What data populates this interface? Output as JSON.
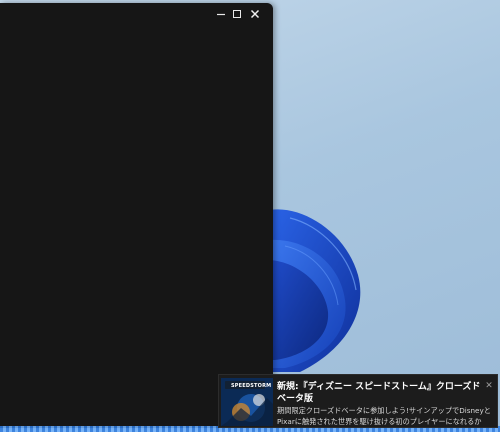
{
  "window": {
    "minimize_glyph": "—",
    "maximize_glyph": "☐",
    "close_glyph": "✕"
  },
  "notification": {
    "thumbnail_brand": "SPEEDSTORM",
    "title": "新規:『ディズニー スピードストーム』クローズドベータ版",
    "body": "期間限定クローズドベータに参加しよう!サインアップでDisneyとPixarに触発された世界を駆け抜ける初のプレイヤーになれるか",
    "close_glyph": "✕"
  },
  "colors": {
    "wallpaper": "#a9c6df",
    "window_bg": "#161616",
    "toast_bg": "#1c1c1c",
    "bloom_blue": "#1f4fd0"
  }
}
